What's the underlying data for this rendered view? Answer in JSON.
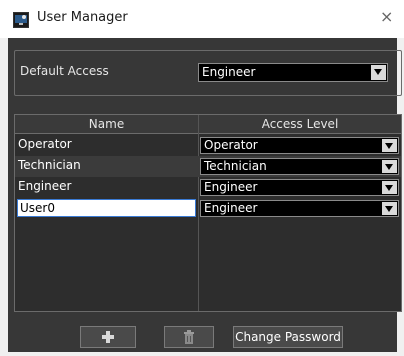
{
  "window": {
    "title": "User Manager",
    "close_glyph": "×"
  },
  "default_access": {
    "label": "Default Access",
    "value": "Engineer"
  },
  "table": {
    "headers": [
      "Name",
      "Access Level"
    ],
    "rows": [
      {
        "name": "Operator",
        "access": "Operator"
      },
      {
        "name": "Technician",
        "access": "Technician"
      },
      {
        "name": "Engineer",
        "access": "Engineer"
      },
      {
        "name": "User0",
        "access": "Engineer"
      }
    ]
  },
  "buttons": {
    "add_icon": "plus-icon",
    "delete_icon": "trash-icon",
    "change_password": "Change Password"
  },
  "colors": {
    "panel_bg": "#373737",
    "select_bg": "#000000",
    "input_focus": "#3a7bd5"
  }
}
